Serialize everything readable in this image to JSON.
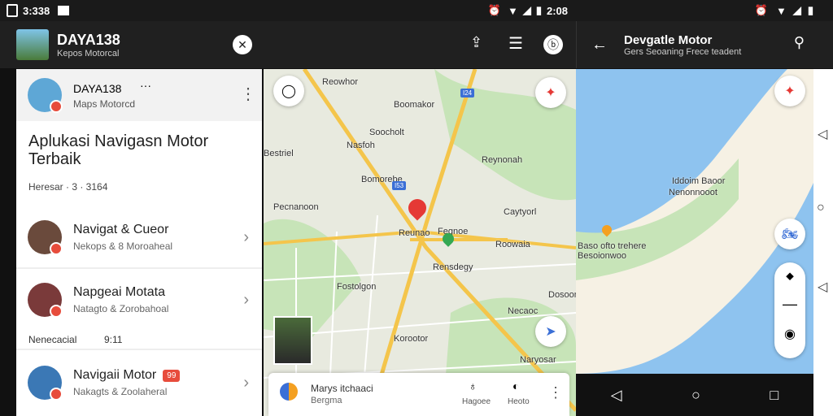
{
  "status_left": {
    "time": "3:338",
    "icons": [
      "sim-icon",
      "mail-icon"
    ]
  },
  "status_mid": {
    "time": "2:08",
    "icons": [
      "alarm-icon",
      "wifi-icon",
      "signal-icon",
      "battery-icon"
    ]
  },
  "status_right": {
    "icons": [
      "alarm-icon",
      "wifi-icon",
      "signal-icon",
      "battery-icon"
    ]
  },
  "left_header": {
    "title": "DAYA138",
    "subtitle": "Kepos Motorcal"
  },
  "right_header": {
    "title": "Devgatle Motor",
    "subtitle": "Gers Seoaning Frece teadent"
  },
  "card": {
    "app_name": "DAYA138",
    "app_sub": "Maps Motorcd",
    "headline": "Aplukasi Navigasn Motor Terbaik",
    "meta": "Heresar · 3 · 3164",
    "items": [
      {
        "title": "Navigat & Cueor",
        "sub": "Nekops & 8 Moroaheal"
      },
      {
        "title": "Napgeai Motata",
        "sub": "Natagto & Zorobahoal"
      },
      {
        "title": "Navigaii Motor",
        "sub": "Nakagts & Zoolaheral",
        "badge": "99"
      }
    ],
    "mid_text": "Nenecacial",
    "mid_num": "9:11"
  },
  "map_labels": [
    "Reowhor",
    "Boomakor",
    "Soocholt",
    "Nasfoh",
    "Bestriel",
    "Reynonah",
    "Pecnanoon",
    "Reunao",
    "Caytyorl",
    "Roowaia",
    "Fegnoe",
    "Rensdegy",
    "Fostolgon",
    "Dosoonolm",
    "Necaoc",
    "Korootor",
    "Naryosar",
    "Bomorebe"
  ],
  "map_routes": [
    "I24",
    "I53"
  ],
  "map2_labels": [
    "Iddoim Baoor",
    "Nenonnooot",
    "Baso ofto trehere",
    "Besoionwoo"
  ],
  "bottom_panel": {
    "title": "Marys itchaaci",
    "sub": "Bergma",
    "btn1": "Hagoee",
    "btn2": "Heoto"
  },
  "colors": {
    "accent": "#e53935",
    "water": "#8ec3ef",
    "park": "#c7e4b8",
    "road": "#f4c54b"
  }
}
